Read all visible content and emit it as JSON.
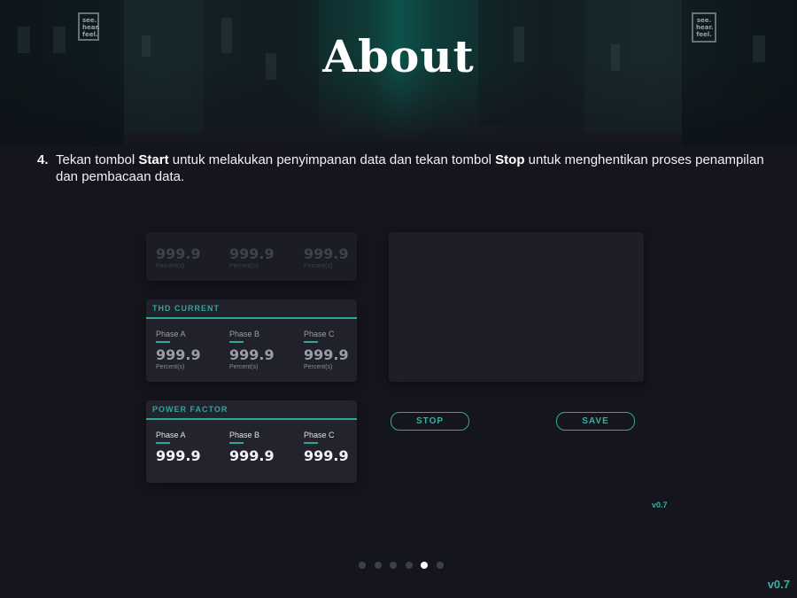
{
  "page": {
    "title": "About"
  },
  "step": {
    "number": "4.",
    "part1": "Tekan tombol ",
    "start": "Start",
    "part2": " untuk melakukan penyimpanan data dan tekan tombol ",
    "stop": "Stop",
    "part3": " untuk menghentikan proses penampilan dan pembacaan data."
  },
  "hero_signs": {
    "left": [
      "see.",
      "hear.",
      "feel."
    ],
    "right": [
      "see.",
      "hear.",
      "feel."
    ]
  },
  "top_card": {
    "phases": [
      {
        "value": "999.9",
        "unit": "Percent(s)"
      },
      {
        "value": "999.9",
        "unit": "Percent(s)"
      },
      {
        "value": "999.9",
        "unit": "Percent(s)"
      }
    ]
  },
  "thd_current": {
    "title": "THD CURRENT",
    "phases": [
      {
        "label": "Phase A",
        "value": "999.9",
        "unit": "Percent(s)"
      },
      {
        "label": "Phase B",
        "value": "999.9",
        "unit": "Percent(s)"
      },
      {
        "label": "Phase C",
        "value": "999.9",
        "unit": "Percent(s)"
      }
    ]
  },
  "power_factor": {
    "title": "POWER FACTOR",
    "phases": [
      {
        "label": "Phase A",
        "value": "999.9"
      },
      {
        "label": "Phase B",
        "value": "999.9"
      },
      {
        "label": "Phase C",
        "value": "999.9"
      }
    ]
  },
  "buttons": {
    "stop": "STOP",
    "save": "SAVE"
  },
  "app_version": "v0.7",
  "pagination": {
    "count": 6,
    "active_index": 4
  },
  "version": "v0.7",
  "colors": {
    "accent": "#2fa798",
    "background": "#15161d"
  }
}
